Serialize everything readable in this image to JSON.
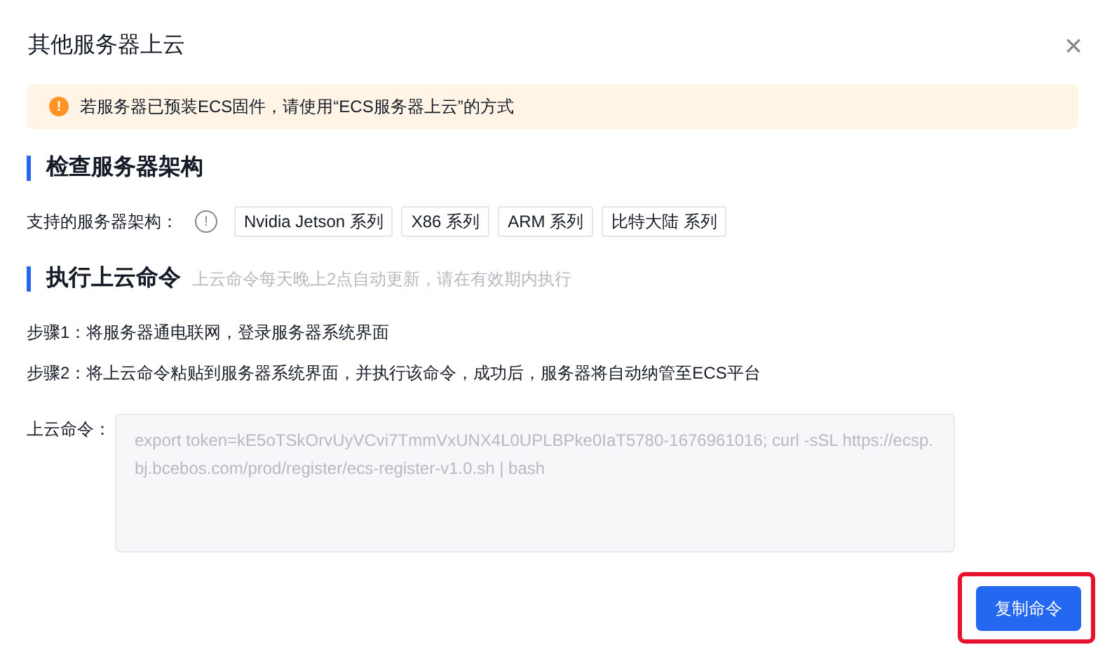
{
  "dialog": {
    "title": "其他服务器上云",
    "close": "×"
  },
  "alert": {
    "icon": "!",
    "text": "若服务器已预装ECS固件，请使用“ECS服务器上云”的方式"
  },
  "section_1": {
    "heading": "检查服务器架构",
    "label": "支持的服务器架构：",
    "info_icon": "!",
    "tags": [
      "Nvidia Jetson 系列",
      "X86 系列",
      "ARM 系列",
      "比特大陆 系列"
    ]
  },
  "section_2": {
    "heading": "执行上云命令",
    "hint": "上云命令每天晚上2点自动更新，请在有效期内执行",
    "steps": [
      "步骤1：将服务器通电联网，登录服务器系统界面",
      "步骤2：将上云命令粘贴到服务器系统界面，并执行该命令，成功后，服务器将自动纳管至ECS平台"
    ],
    "command_label": "上云命令：",
    "command": {
      "value": "export token=kE5oTSkOrvUyVCvi7TmmVxUNX4L0UPLBPke0IaT5780-1676961016; curl -sSL https://ecsp.bj.bcebos.com/prod/register/ecs-register-v1.0.sh | bash",
      "disabled": true
    }
  },
  "copy_button": {
    "label": "复制命令",
    "highlighted": true
  }
}
